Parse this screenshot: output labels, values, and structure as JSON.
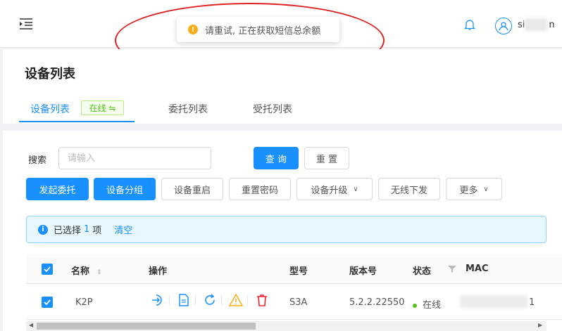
{
  "topbar": {
    "menu_icon": "menu-fold-icon",
    "bell_icon": "bell-icon",
    "avatar_icon": "user-avatar-icon",
    "username_visible": "si",
    "username_suffix": "n"
  },
  "toast": {
    "icon": "warning-icon",
    "message": "请重试, 正在获取短信总余额"
  },
  "page": {
    "title": "设备列表"
  },
  "tabs": [
    {
      "label": "设备列表",
      "active": true
    },
    {
      "label": "委托列表",
      "active": false
    },
    {
      "label": "受托列表",
      "active": false
    }
  ],
  "online_badge": "在线 ⇋",
  "search": {
    "label": "搜索",
    "placeholder": "请输入",
    "query_label": "查 询",
    "reset_label": "重 置"
  },
  "actions": {
    "delegate": "发起委托",
    "group": "设备分组",
    "reboot": "设备重启",
    "reset_password": "重置密码",
    "upgrade": "设备升级",
    "wireless": "无线下发",
    "more": "更多"
  },
  "selection": {
    "prefix": "已选择",
    "count": "1",
    "suffix": "项",
    "clear": "清空"
  },
  "table": {
    "columns": {
      "name": "名称",
      "ops": "操作",
      "model": "型号",
      "version": "版本号",
      "status": "状态",
      "mac": "MAC"
    },
    "rows": [
      {
        "name": "K2P",
        "model": "S3A",
        "version": "5.2.2.22550",
        "status": "在线",
        "mac_tail": "1"
      }
    ]
  },
  "colors": {
    "primary": "#1890ff",
    "success": "#52c41a",
    "warning": "#faad14",
    "danger": "#f5222d",
    "annotation": "#e02020"
  }
}
